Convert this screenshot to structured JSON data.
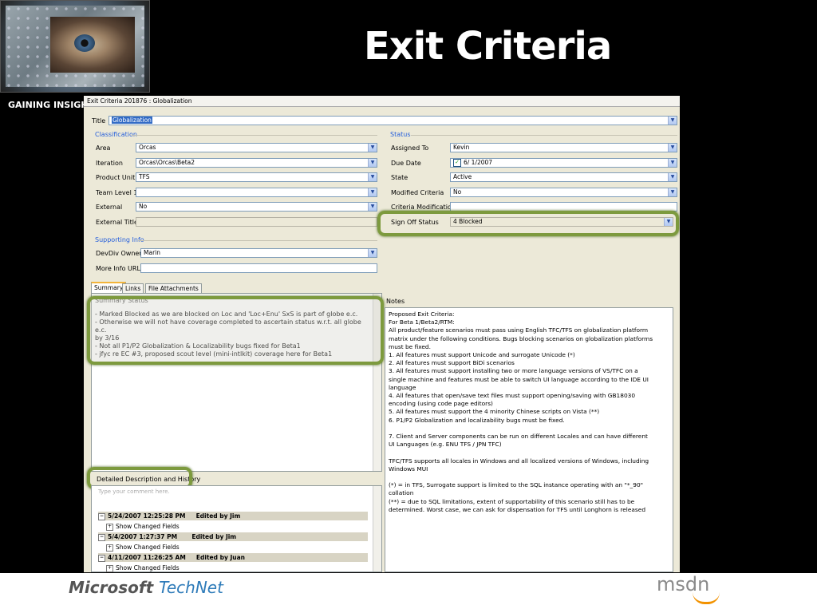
{
  "slide": {
    "title": "Exit Criteria",
    "side_label": "GAINING INSIGHT",
    "footer_brand_1": "Microsoft",
    "footer_brand_2": "TechNet",
    "footer_brand_3": "msdn"
  },
  "window": {
    "title": "Exit Criteria 201876 : Globalization",
    "title_label": "Title",
    "title_value": "Globalization"
  },
  "classification": {
    "header": "Classification",
    "area_label": "Area",
    "area_value": "Orcas",
    "iteration_label": "Iteration",
    "iteration_value": "Orcas\\Orcas\\Beta2",
    "product_label": "Product Unit",
    "product_value": "TFS",
    "team_label": "Team Level 1",
    "team_value": "",
    "external_label": "External",
    "external_value": "No",
    "ext_title_label": "External Title",
    "ext_title_value": ""
  },
  "status": {
    "header": "Status",
    "assigned_label": "Assigned To",
    "assigned_value": "Kevin",
    "due_label": "Due Date",
    "due_value": "6/ 1/2007",
    "state_label": "State",
    "state_value": "Active",
    "modified_label": "Modified Criteria",
    "modified_value": "No",
    "mods_label": "Criteria Modifications",
    "mods_value": "",
    "signoff_label": "Sign Off Status",
    "signoff_value": "4 Blocked"
  },
  "supporting": {
    "header": "Supporting Info",
    "devdiv_label": "DevDiv Owner",
    "devdiv_value": "Marin",
    "moreinfo_label": "More Info URL:",
    "moreinfo_value": ""
  },
  "tabs": [
    "Summary",
    "Links",
    "File Attachments"
  ],
  "summary": {
    "header": "Summary Status",
    "lines": [
      "- Marked Blocked as we are blocked on Loc and 'Loc+Enu' SxS is part of globe e.c.",
      "- Otherwise we will not have coverage completed to ascertain status w.r.t. all globe e.c.",
      "by 3/16",
      "- Not all P1/P2 Globalization & Localizability bugs fixed for Beta1",
      "- jfyc re EC #3, proposed scout level (mini-intlkit) coverage here for Beta1"
    ]
  },
  "history": {
    "button": "Detailed Description and History",
    "placeholder": "Type your comment here.",
    "entries": [
      {
        "date": "5/24/2007 12:25:28 PM",
        "by": "Edited by Jim",
        "sub": "Show Changed Fields"
      },
      {
        "date": "5/4/2007 1:27:37 PM",
        "by": "Edited by Jim",
        "sub": "Show Changed Fields"
      },
      {
        "date": "4/11/2007 11:26:25 AM",
        "by": "Edited by Juan",
        "sub": "Show Changed Fields"
      }
    ]
  },
  "notes": {
    "header": "Notes",
    "lines": [
      "Proposed Exit Criteria:",
      "For Beta 1/Beta2/RTM:",
      "All product/feature scenarios must pass using English TFC/TFS on globalization platform",
      "matrix under the following conditions.  Bugs blocking scenarios on globalization platforms",
      "must be fixed.",
      "1.      All features must support Unicode and surrogate Unicode (*)",
      "2.      All features must support BiDi scenarios",
      "3.      All features must support installing two or more language versions of VS/TFC on a",
      "single machine and features must be able to switch UI language according to the IDE UI",
      "language",
      "4.      All features that open/save text files must support opening/saving with GB18030",
      "encoding (using code page editors)",
      "5.      All features must support the 4 minority Chinese scripts on Vista (**)",
      "6.      P1/P2 Globalization and localizability bugs must be fixed.",
      "",
      "7.   Client and Server components can be run on different Locales and can have different",
      "UI Languages (e.g. ENU TFS / JPN TFC)",
      "",
      "TFC/TFS supports all locales in Windows and all localized versions of Windows, including",
      "Windows MUI",
      "",
      "(*) = in TFS, Surrogate support is limited to the SQL instance operating with an \"*_90\"",
      "collation",
      "(**) = due to SQL limitations, extent of supportability of this scenario still has to be",
      "determined. Worst case, we can ask for dispensation for TFS until Longhorn is released"
    ]
  }
}
